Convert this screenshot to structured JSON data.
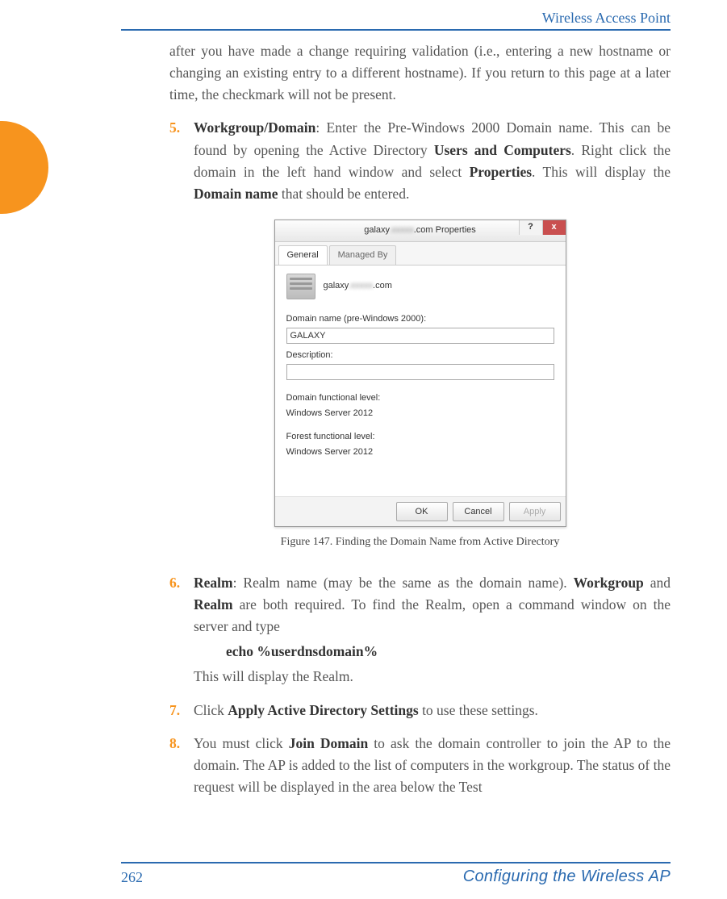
{
  "header": {
    "title": "Wireless Access Point"
  },
  "body": {
    "intro": "after you have made a change requiring validation (i.e., entering a new hostname or changing an existing entry to a different hostname). If you return to this page at a later time, the checkmark will not be present.",
    "items": [
      {
        "num": "5.",
        "lead": "Workgroup/Domain",
        "text_a": ": Enter the Pre-Windows 2000 Domain name. This can be found by opening the Active Directory ",
        "bold_a": "Users and Computers",
        "text_b": ". Right click the domain in the left hand window and select ",
        "bold_b": "Properties",
        "text_c": ". This will display the ",
        "bold_c": "Domain name",
        "text_d": " that should be entered."
      },
      {
        "num": "6.",
        "lead": "Realm",
        "text_a": ": Realm name (may be the same as the domain name). ",
        "bold_a": "Workgroup",
        "text_b": " and ",
        "bold_b": "Realm",
        "text_c": " are both required. To find the Realm, open a command window on the server and type",
        "cmd": "echo %userdnsdomain%",
        "tail": "This will display the Realm."
      },
      {
        "num": "7.",
        "text_a": "Click ",
        "bold_a": "Apply Active Directory Settings",
        "text_b": " to use these settings."
      },
      {
        "num": "8.",
        "text_a": "You must click ",
        "bold_a": "Join Domain",
        "text_b": " to ask the domain controller to join the AP to the domain. The AP is added to the list of computers in the workgroup. The status of the request will be displayed in the area below the Test"
      }
    ]
  },
  "dialog": {
    "title_prefix": "galaxy",
    "title_suffix": ".com Properties",
    "help": "?",
    "close": "x",
    "tabs": {
      "general": "General",
      "managed": "Managed By"
    },
    "domain_line_prefix": "galaxy",
    "domain_line_suffix": ".com",
    "label_domain": "Domain name (pre-Windows 2000):",
    "value_domain": "GALAXY",
    "label_desc": "Description:",
    "value_desc": "",
    "label_dfl": "Domain functional level:",
    "value_dfl": "Windows Server 2012",
    "label_ffl": "Forest functional level:",
    "value_ffl": "Windows Server 2012",
    "btn_ok": "OK",
    "btn_cancel": "Cancel",
    "btn_apply": "Apply"
  },
  "figure": {
    "caption": "Figure 147. Finding the Domain Name from Active Directory"
  },
  "footer": {
    "page": "262",
    "section": "Configuring the Wireless AP"
  }
}
